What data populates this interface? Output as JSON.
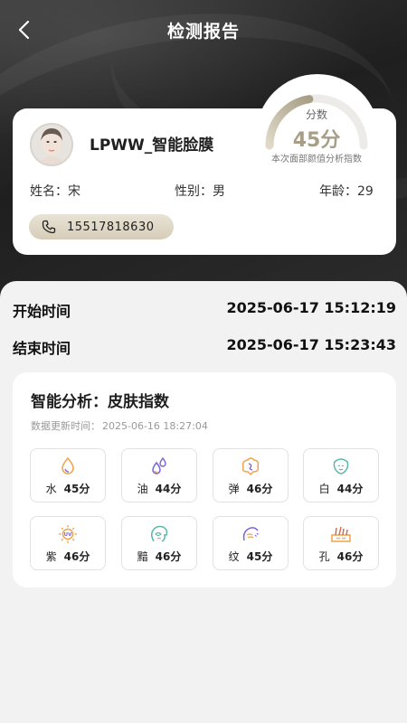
{
  "header": {
    "title": "检测报告",
    "back_icon": "chevron-left-icon"
  },
  "gauge": {
    "label": "分数",
    "score": "45分",
    "score_fraction": 0.45,
    "caption": "本次面部颜值分析指数"
  },
  "profile": {
    "product_name": "LPWW_智能脸膜",
    "name_label": "姓名：",
    "name_value": "宋",
    "gender_label": "性别：",
    "gender_value": "男",
    "age_label": "年龄：",
    "age_value": "29",
    "phone": "15517818630",
    "phone_icon": "phone-icon"
  },
  "times": {
    "start_label": "开始时间",
    "start_value": "2025-06-17 15:12:19",
    "end_label": "结束时间",
    "end_value": "2025-06-17 15:23:43"
  },
  "analysis": {
    "title": "智能分析：皮肤指数",
    "update_label": "数据更新时间：",
    "update_value": "2025-06-16 18:27:04",
    "metrics": [
      {
        "label": "水",
        "value": "45分",
        "icon": "water-drop-icon"
      },
      {
        "label": "油",
        "value": "44分",
        "icon": "oil-drops-icon"
      },
      {
        "label": "弹",
        "value": "46分",
        "icon": "elasticity-icon"
      },
      {
        "label": "白",
        "value": "44分",
        "icon": "face-whitening-icon"
      },
      {
        "label": "紫",
        "value": "46分",
        "icon": "uv-sun-icon"
      },
      {
        "label": "黯",
        "value": "46分",
        "icon": "dullness-face-icon"
      },
      {
        "label": "纹",
        "value": "45分",
        "icon": "wrinkle-icon"
      },
      {
        "label": "孔",
        "value": "46分",
        "icon": "pore-icon"
      }
    ]
  },
  "colors": {
    "accent_gold": "#a89e86",
    "dark_bg": "#2a2a2a",
    "icon_orange": "#f0a24a",
    "icon_purple": "#7b61d6"
  }
}
